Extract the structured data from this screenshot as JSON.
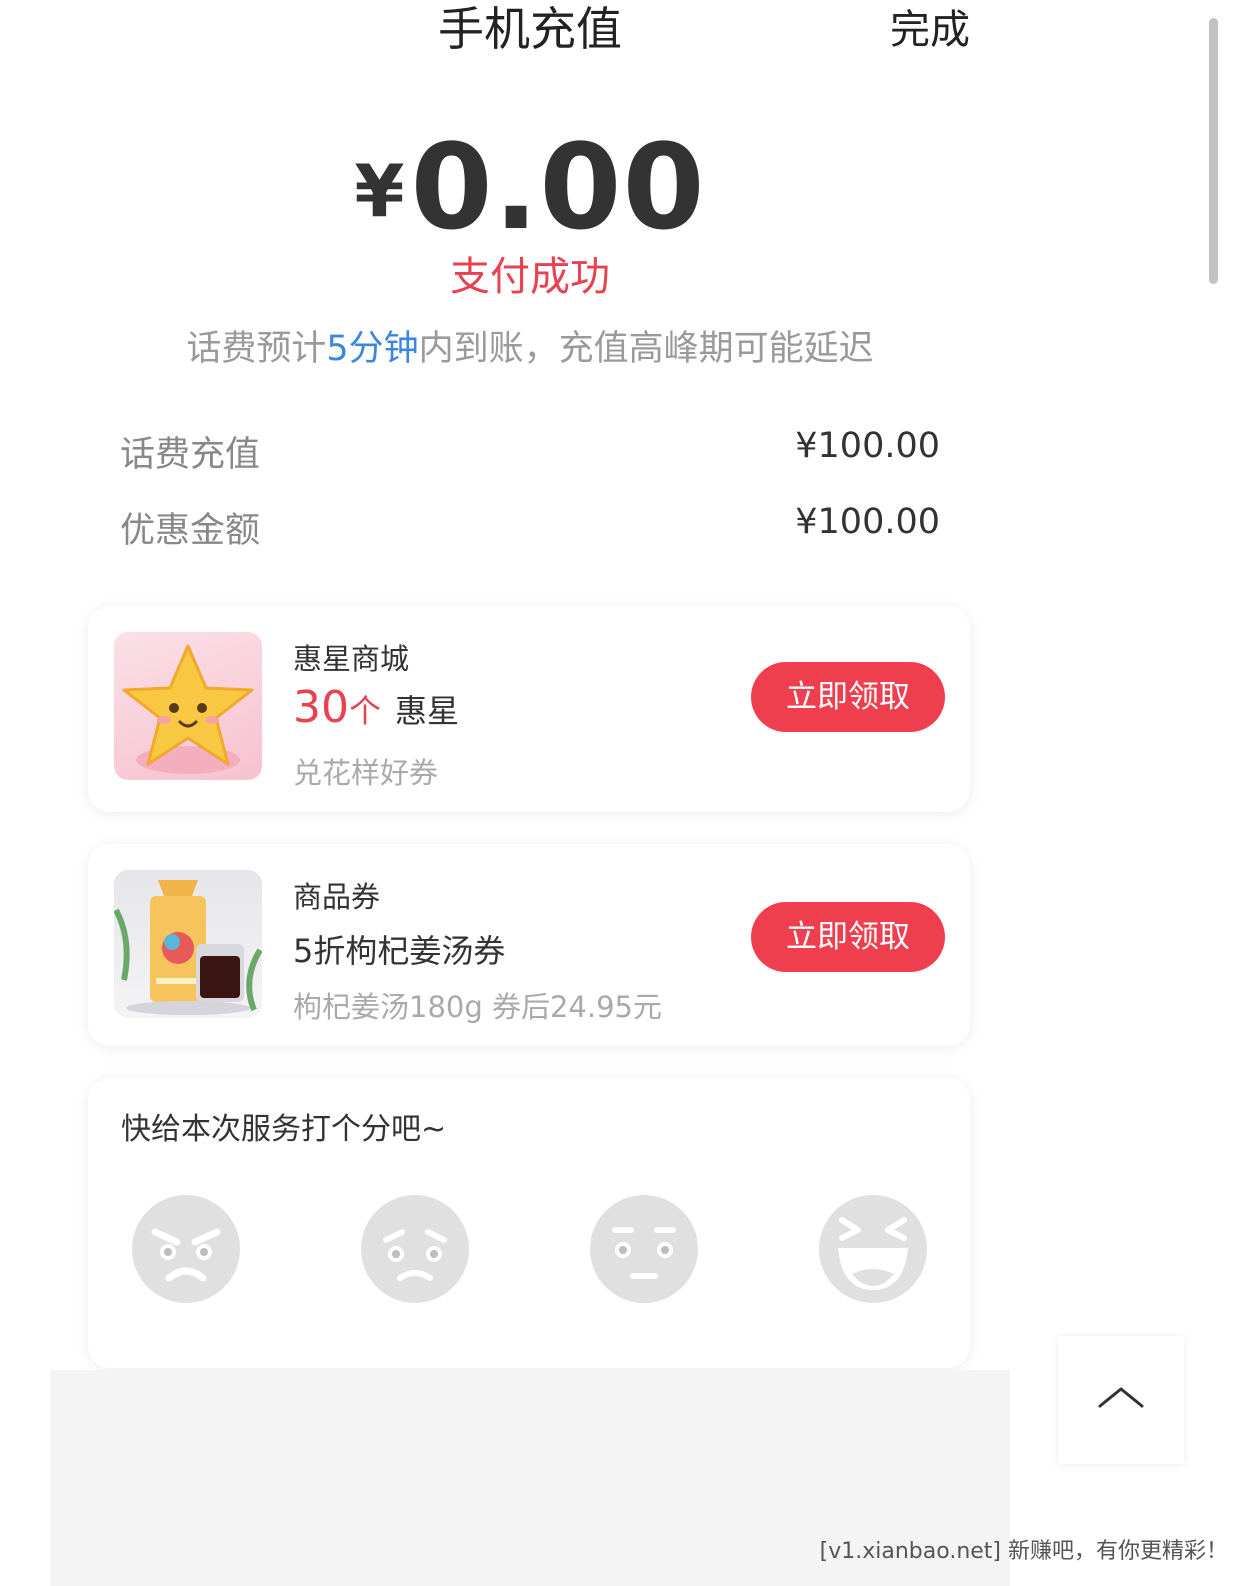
{
  "header": {
    "title": "手机充值",
    "done_label": "完成"
  },
  "payment": {
    "currency_symbol": "¥",
    "amount": "0.00",
    "status": "支付成功",
    "note_prefix": "话费预计",
    "note_highlight": "5分钟",
    "note_suffix": "内到账，充值高峰期可能延迟"
  },
  "details": [
    {
      "label": "话费充值",
      "value": "¥100.00"
    },
    {
      "label": "优惠金额",
      "value": "¥100.00"
    }
  ],
  "cards": [
    {
      "title": "惠星商城",
      "count": "30",
      "unit": "个",
      "name": "惠星",
      "sub": "兑花样好券",
      "button": "立即领取",
      "image": "star-mascot-image"
    },
    {
      "title": "商品券",
      "main": "5折枸杞姜汤券",
      "sub": "枸杞姜汤180g 券后24.95元",
      "button": "立即领取",
      "image": "goji-ginger-soup-product-image"
    }
  ],
  "rating": {
    "title": "快给本次服务打个分吧~",
    "faces": [
      "angry-face-icon",
      "sad-face-icon",
      "neutral-face-icon",
      "laughing-face-icon"
    ]
  },
  "back_to_top": {
    "icon": "chevron-up-icon"
  },
  "watermark": "[v1.xianbao.net] 新赚吧，有你更精彩！",
  "colors": {
    "accent_red": "#ef3f4f",
    "status_red": "#e8414f",
    "highlight_blue": "#3b86e0",
    "face_gray": "#e0e0e0"
  }
}
